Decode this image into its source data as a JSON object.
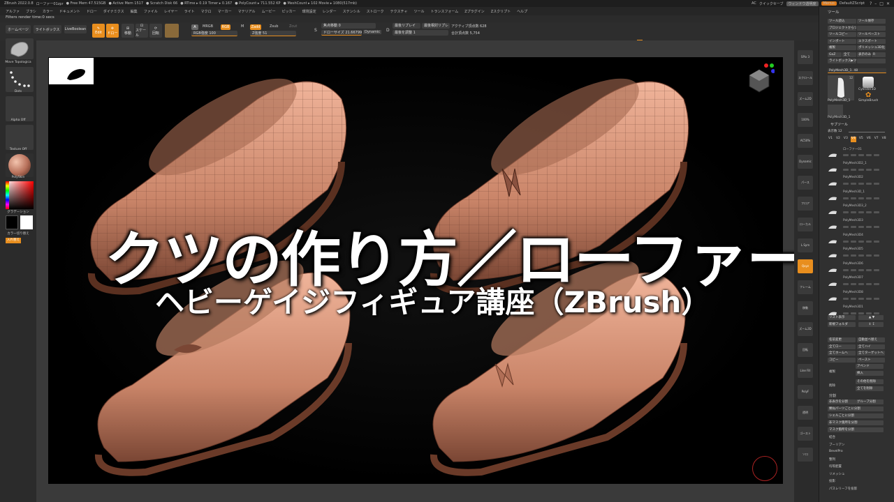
{
  "titlebar": {
    "app": "ZBrush 2022.0.8",
    "file": "ローファー01zpr",
    "stats": [
      "● Free Mem 47.515GB",
      "● Active Mem 1517",
      "● Scratch Disk 66",
      "● RTime ▸ 0.19 Timer ▸ 0.167",
      "● PolyCount ▸ 711.552 KP",
      "● MeshCount ▸ 102 Movie ▸ 1080(517mb)"
    ],
    "ac": "AC",
    "quicksave": "クイックセーブ",
    "transparency": "ウィンドウ透明度",
    "menus": "Menus",
    "zscript": "DefaultZScript"
  },
  "menu": [
    "アルファ",
    "ブラシ",
    "カラー",
    "ドキュメント",
    "ドロー",
    "ダイナミクス",
    "編集",
    "ファイル",
    "レイヤー",
    "ライト",
    "マクロ",
    "マーカー",
    "マテリアル",
    "ムービー",
    "ピッカー",
    "環境設定",
    "レンダー",
    "ステンシル",
    "ストローク",
    "テクスチャ",
    "ツール",
    "トランスフォーム",
    "Zプラグイン",
    "Zスクリプト",
    "ヘルプ"
  ],
  "status": "Filters render time:0 secs",
  "toptools": {
    "home": "ホームページ",
    "lightbox": "ライトボックス",
    "liveboolean": "LiveBoolean",
    "edit": "Edit",
    "draw": "ドロー",
    "move": "移動",
    "scale": "スケール",
    "rotate": "回転",
    "a": "A",
    "mrgb": "MRGB",
    "rgb": "RGB",
    "m": "M",
    "zadd": "Zadd",
    "zsub": "Zsub",
    "zcut": "Zcut",
    "rgb_intensity": "RGB強度 100",
    "z_intensity": "Z強度 51",
    "focal": "焦点移動 0",
    "drawsize": "ドローサイズ 21.66799",
    "dynamic": "Dynamic",
    "s": "S",
    "d": "D",
    "last_replay": "最後リプレイ",
    "last_relative": "最後相対リプレ",
    "active_points": "アクティブ頂点数 628",
    "adjust": "最後を調整 1",
    "total_points": "合計頂点数 5,754"
  },
  "leftshelf": {
    "brush": "Move Topologica",
    "stroke": "Dots",
    "alpha": "Alpha Off",
    "texture": "Texture Off",
    "material": "PolySkin",
    "gradient": "グラデーション",
    "swap": "カラー切り替え",
    "fill": "入れ替え"
  },
  "rightshelf": [
    "SPix 3",
    "スクロール",
    "ズーム2D",
    "100%",
    "AC50%",
    "Dynamic",
    "パース",
    "フロア",
    "ローカル",
    "L.Sym",
    "Qxyz",
    "フレーム",
    "移動",
    "ズーム3D",
    "回転",
    "Line Fill",
    "PolyF",
    "透明",
    "ゴースト",
    "ソロ"
  ],
  "panel": {
    "header": "ツール",
    "buttons": [
      [
        "ツール読込",
        "ツール保存"
      ],
      [
        "プロジェクトからツール読込",
        ""
      ],
      [
        "ツールコピー",
        "ツールペースト"
      ],
      [
        "インポート",
        "エクスポート"
      ],
      [
        "複製",
        "ポリメッシュ3D化"
      ],
      [
        "GoZ",
        "全て",
        "表示のみ",
        "R"
      ],
      [
        "ライトボックス▶ツール",
        ""
      ]
    ],
    "current_tool": "PolyMesh3D_1. 48",
    "thumb_count": "12",
    "thumbs": [
      "PolyMesh3D_1",
      "Cylinder3D",
      "PolyMesh3D_1",
      "SimpleBrush"
    ],
    "subtool_header": "サブツール",
    "visible_count": "表示数 12",
    "versions": [
      "V1",
      "V2",
      "V3",
      "V4",
      "V5",
      "V6",
      "V7",
      "V8"
    ],
    "subtools": [
      "ローファー01",
      "PolyMesh3D2_1",
      "PolyMesh3D2",
      "PolyMesh3D_1",
      "PolyMesh3D3_2",
      "PolyMesh3D3",
      "PolyMesh3D4",
      "PolyMesh3D5",
      "PolyMesh3D6",
      "PolyMesh3D7",
      "PolyMesh3D8",
      "PolyMesh3D1"
    ],
    "list_all": "リスト表示",
    "new_folder": "新規フォルダ",
    "ops": [
      [
        "名前変更",
        "自動並べ替え"
      ],
      [
        "全てロー",
        "全てハイ"
      ],
      [
        "全てホームへ",
        "全てターゲットへ"
      ],
      [
        "コピー",
        "ペースト"
      ]
    ],
    "dup": "複製",
    "append": "アペンド",
    "insert": "挿入",
    "delete": "削除",
    "delete_other": "その他を削除",
    "delete_all": "全てを削除",
    "split_header": "分割",
    "split": [
      "非表示を分割",
      "グループ分割",
      "類似パーツごとに分割",
      "シェルごとに分割",
      "非マスク箇所を分割",
      "マスク箇所を分割"
    ],
    "misc": [
      "結合",
      "ブーリアン",
      "BevelPro",
      "整列",
      "均等配置",
      "リメッシュ",
      "投影",
      "パスレリーフを投影"
    ]
  },
  "thumb_text": {
    "xyz": "",
    "hud": ""
  },
  "overlay": {
    "title": "クツの作り方／ローファー",
    "subtitle": "ヘビーゲイジフィギュア講座（ZBrush）"
  },
  "colors": {
    "accent": "#e88e1e",
    "shoe_base": "#c98468",
    "shoe_shadow": "#7a4634",
    "shoe_light": "#f0b49a",
    "wire": "#5a3328"
  }
}
